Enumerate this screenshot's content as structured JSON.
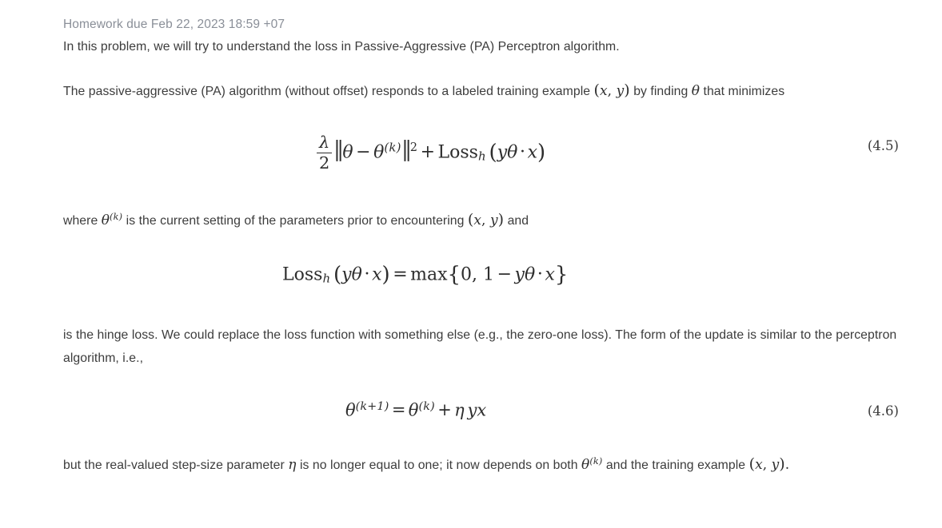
{
  "document": {
    "due_line": "Homework due Feb 22, 2023 18:59 +07",
    "intro": "In this problem, we will try to understand the loss in Passive-Aggressive (PA) Perceptron algorithm.",
    "paragraph_1": {
      "part_a": "The passive-aggressive (PA) algorithm (without offset) responds to a labeled training example",
      "math_xy": "(x, y)",
      "part_b": "by finding",
      "math_theta": "θ",
      "part_c": "that minimizes"
    },
    "equation_1": {
      "tag": "(4.5)",
      "latex": "\\frac{\\lambda}{2}\\left\\lVert\\theta-\\theta^{(k)}\\right\\rVert^{2}+\\mathrm{Loss}_{h}\\left(y\\theta\\cdot x\\right)",
      "lambda": "λ",
      "denominator": "2",
      "theta": "θ",
      "minus": "−",
      "superscript_k": "(k)",
      "exponent": "2",
      "plus": "+",
      "loss_name": "Loss",
      "loss_subscript": "h",
      "y": "y",
      "cdot": "·",
      "x": "x"
    },
    "paragraph_2": {
      "part_a": "where",
      "math_theta_k": "θ(k)",
      "part_b": "is the current setting of the parameters prior to encountering",
      "math_xy": "(x, y)",
      "part_c": "and"
    },
    "equation_2": {
      "tag": "",
      "latex": "\\mathrm{Loss}_{h}\\left(y\\theta\\cdot x\\right)=\\max\\{0,1-y\\theta\\cdot x\\}",
      "loss_name": "Loss",
      "loss_subscript": "h",
      "equals": "=",
      "max_name": "max",
      "zero": "0",
      "comma": ",",
      "one": "1",
      "minus": "−"
    },
    "paragraph_3": {
      "line_1": "is the hinge loss. We could replace the loss function with something else (e.g., the zero-one loss). The form of the update is",
      "line_2": "similar to the perceptron algorithm, i.e.,"
    },
    "equation_3": {
      "tag": "(4.6)",
      "latex": "\\theta^{(k+1)}=\\theta^{(k)}+\\eta\\,yx",
      "theta": "θ",
      "superscript_k1": "(k+1)",
      "equals": "=",
      "superscript_k": "(k)",
      "plus": "+",
      "eta": "η",
      "yx": "yx"
    },
    "paragraph_4": {
      "part_a": "but the real-valued step-size parameter",
      "math_eta": "η",
      "part_b": "is no longer equal to one; it now depends on both",
      "math_theta_k": "θ(k)",
      "part_c": "and the training example",
      "math_xy": "(x, y)",
      "period": "."
    }
  },
  "colors": {
    "background": "#ffffff",
    "body_text": "#3c3c3c",
    "muted_text": "#8a8f98",
    "math_text": "#2e2e2e"
  }
}
